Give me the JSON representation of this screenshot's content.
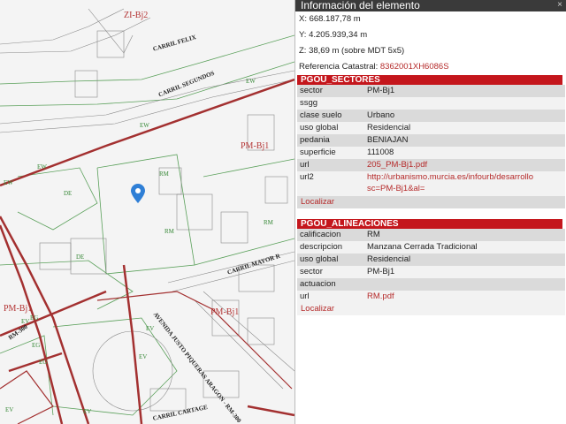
{
  "map": {
    "labels": [
      {
        "key": "zi_bj2",
        "text": "ZI-Bj2"
      },
      {
        "key": "pm_bj1_a",
        "text": "PM-Bj1"
      },
      {
        "key": "pm_bj1_b",
        "text": "PM-Bj1"
      },
      {
        "key": "pm_bj1_c",
        "text": "PM-Bj1"
      }
    ],
    "zones": [
      "EW",
      "EW",
      "EW",
      "EW",
      "DE",
      "DE",
      "RM",
      "RM",
      "RM",
      "EV",
      "EV",
      "EV",
      "EG",
      "EG",
      "EG",
      "EV",
      "EV"
    ],
    "streets": [
      "CARRIL FELIX",
      "CARRIL SEGUNDOS",
      "CARRIL MAYOR R",
      "AVENIDA JUSTO PIQUERAS ARAGON - RM-300",
      "CARRIL CARTAGE"
    ],
    "extra_label": "RM-300"
  },
  "panel": {
    "title": "Información del elemento",
    "close": "×",
    "x": "X: 668.187,78 m",
    "y": "Y: 4.205.939,34 m",
    "z": "Z: 38,69 m (sobre MDT 5x5)",
    "ref_label": "Referencia Catastral: ",
    "ref_value": "8362001XH6086S",
    "sectores": {
      "title": "PGOU_SECTORES",
      "rows": [
        {
          "k": "sector",
          "v": "PM-Bj1"
        },
        {
          "k": "ssgg",
          "v": ""
        },
        {
          "k": "clase suelo",
          "v": "Urbano"
        },
        {
          "k": "uso global",
          "v": "Residencial"
        },
        {
          "k": "pedania",
          "v": "BENIAJAN"
        },
        {
          "k": "superficie",
          "v": "111008"
        },
        {
          "k": "url",
          "v": "205_PM-Bj1.pdf"
        },
        {
          "k": "url2",
          "v": "http://urbanismo.murcia.es/infourb/desarrollo sc=PM-Bj1&al="
        }
      ],
      "locate": "Localizar"
    },
    "alineaciones": {
      "title": "PGOU_ALINEACIONES",
      "rows": [
        {
          "k": "calificacion",
          "v": "RM"
        },
        {
          "k": "descripcion",
          "v": "Manzana Cerrada Tradicional"
        },
        {
          "k": "uso global",
          "v": "Residencial"
        },
        {
          "k": "sector",
          "v": "PM-Bj1"
        },
        {
          "k": "actuacion",
          "v": ""
        },
        {
          "k": "url",
          "v": "RM.pdf"
        }
      ],
      "locate": "Localizar"
    }
  }
}
